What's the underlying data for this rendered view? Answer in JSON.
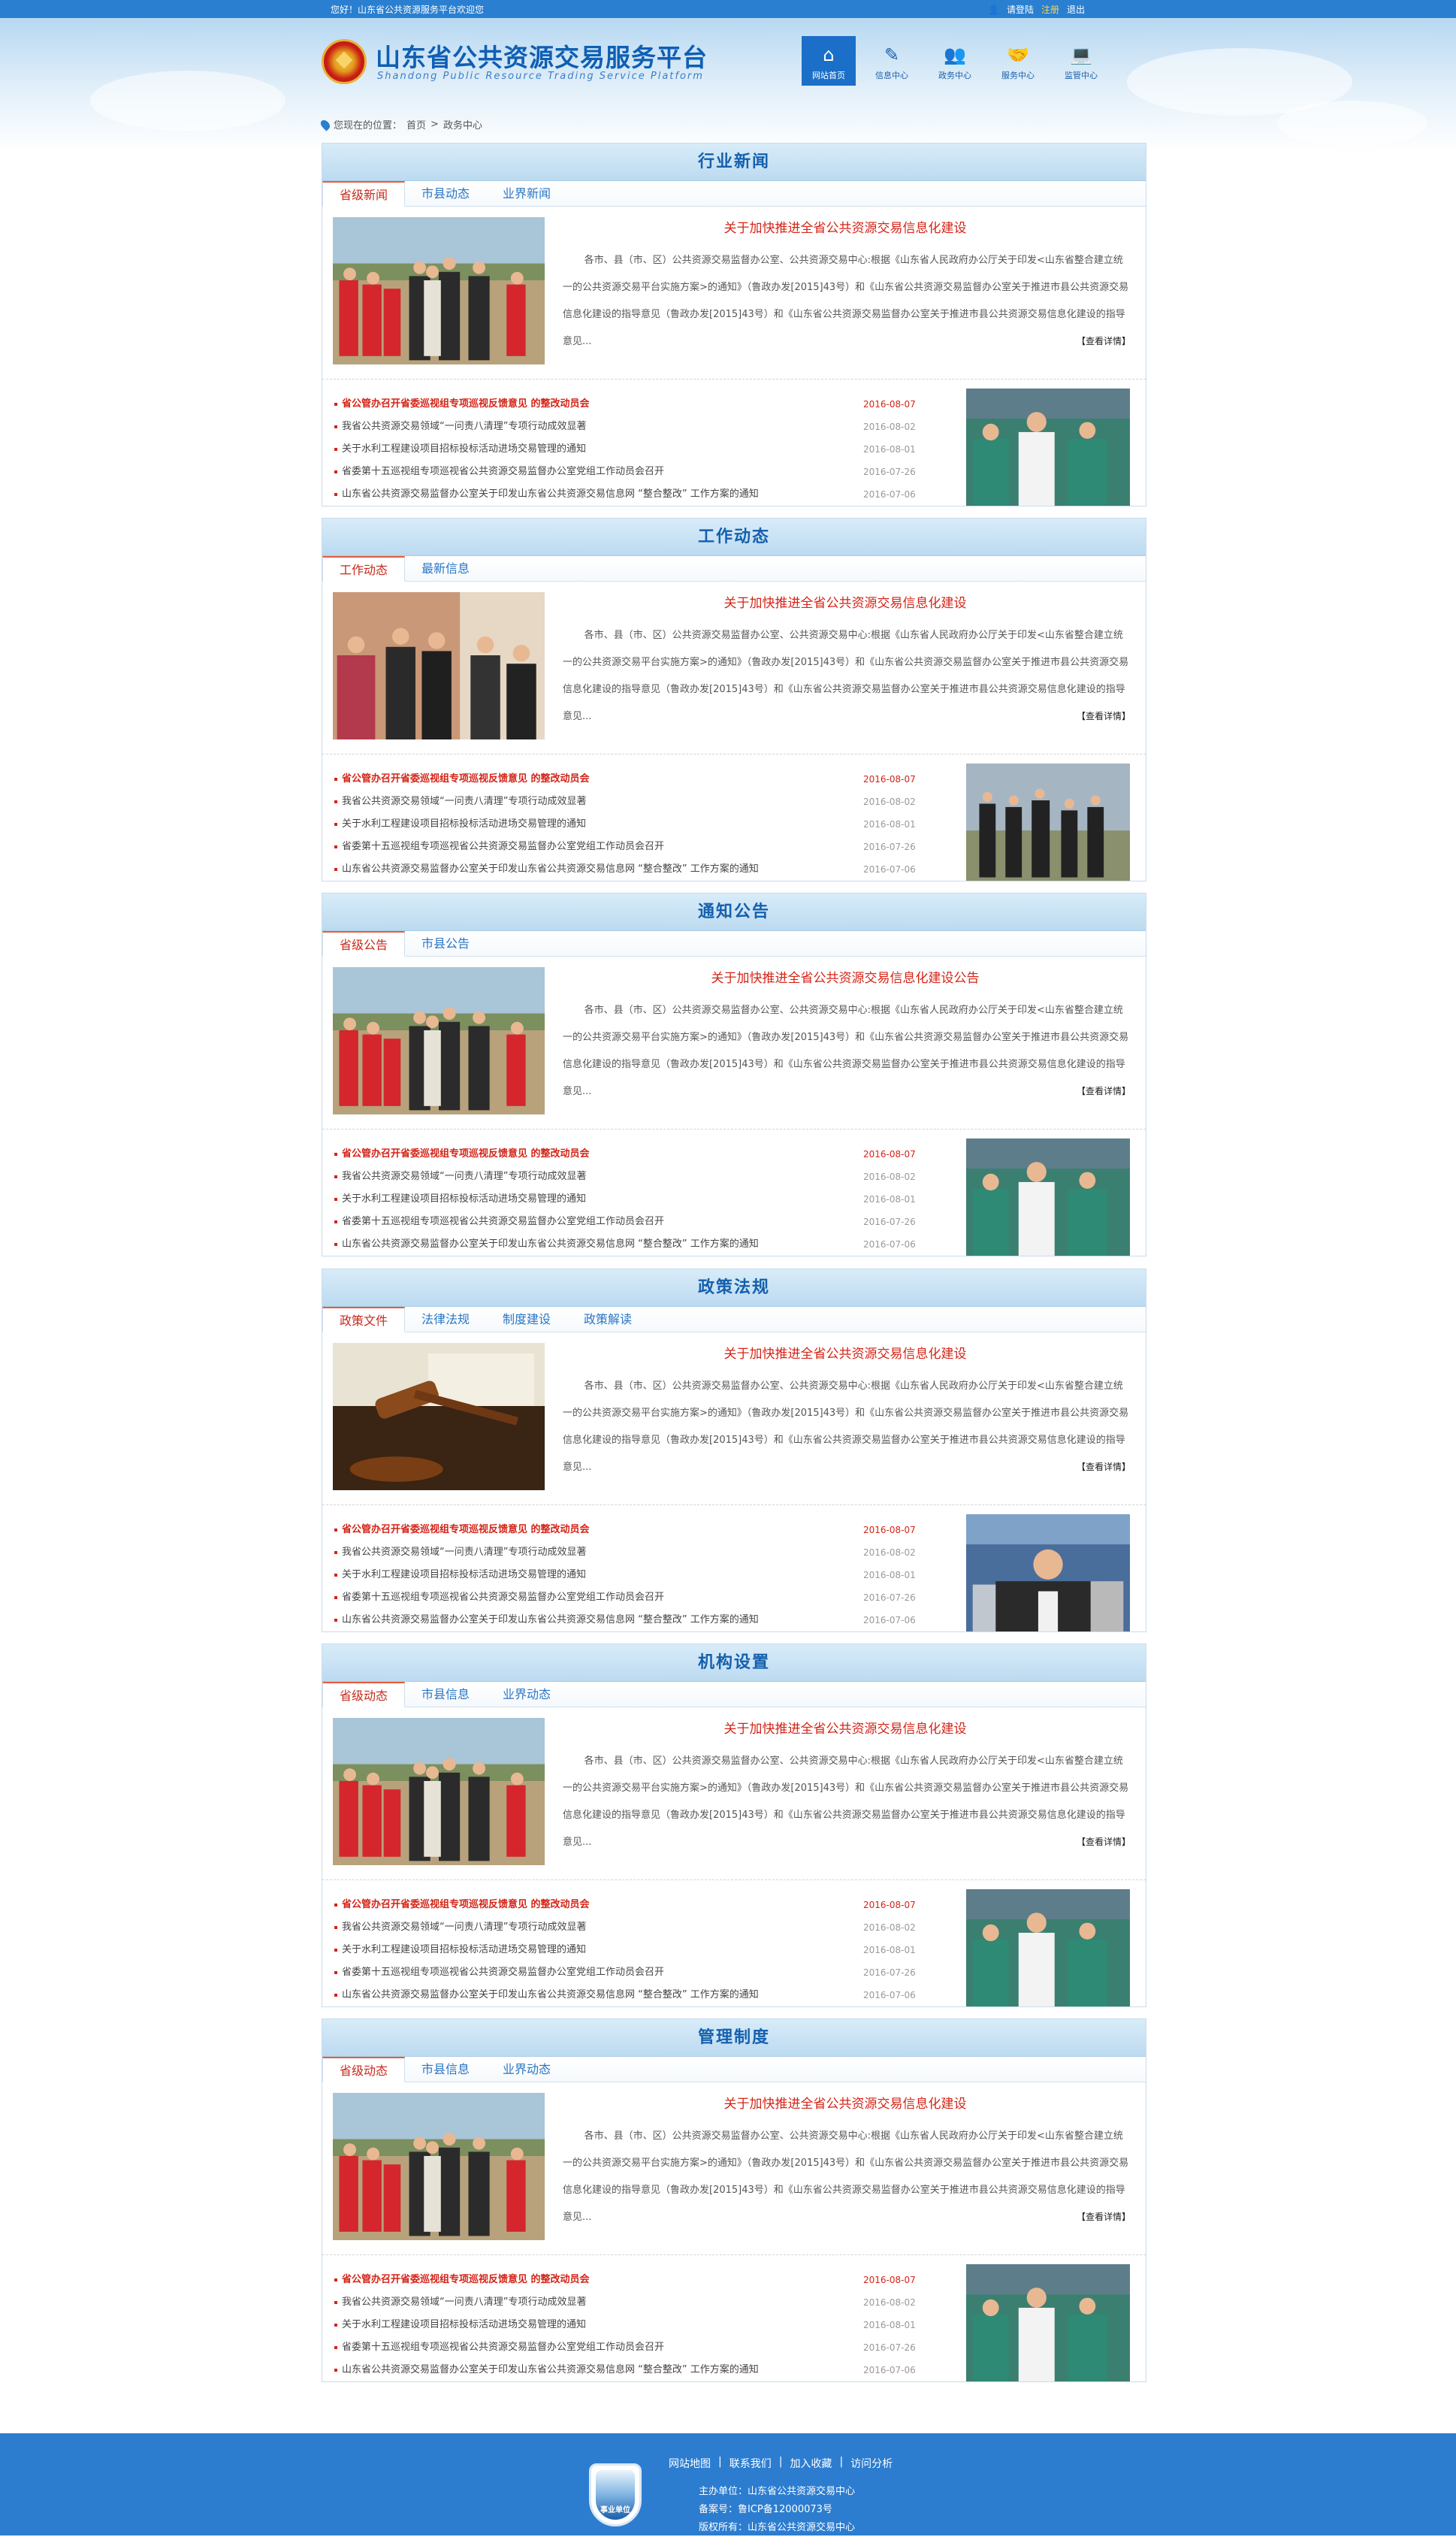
{
  "topbar": {
    "greeting": "您好！山东省公共资源服务平台欢迎您",
    "login": "请登陆",
    "register": "注册",
    "logout": "退出"
  },
  "header": {
    "title": "山东省公共资源交易服务平台",
    "subtitle": "Shandong Public Resource Trading Service Platform"
  },
  "nav": [
    {
      "label": "网站首页",
      "icon": "home-icon",
      "active": true
    },
    {
      "label": "信息中心",
      "icon": "pen-icon"
    },
    {
      "label": "政务中心",
      "icon": "users-icon"
    },
    {
      "label": "服务中心",
      "icon": "handshake-icon"
    },
    {
      "label": "监管中心",
      "icon": "computer-icon"
    }
  ],
  "breadcrumb": {
    "prefix": "您现在的位置：",
    "home": "首页",
    "sep": ">",
    "current": "政务中心"
  },
  "sections": [
    {
      "title": "行业新闻",
      "tabs": [
        "省级新闻",
        "市县动态",
        "业界新闻"
      ],
      "feature_title": "关于加快推进全省公共资源交易信息化建设",
      "summary": "各市、县（市、区）公共资源交易监督办公室、公共资源交易中心:根据《山东省人民政府办公厅关于印发<山东省整合建立统一的公共资源交易平台实施方案>的通知》（鲁政办发[2015]43号）和《山东省公共资源交易监督办公室关于推进市县公共资源交易信息化建设的指导意见（鲁政办发[2015]43号）和《山东省公共资源交易监督办公室关于推进市县公共资源交易信息化建设的指导意见...",
      "more": "【查看详情】",
      "news": [
        {
          "title": "省公管办召开省委巡视组专项巡视反馈意见 的整改动员会",
          "date": "2016-08-07",
          "hot": true
        },
        {
          "title": "我省公共资源交易领域“一问责八清理”专项行动成效显著",
          "date": "2016-08-02"
        },
        {
          "title": "关于水利工程建设项目招标投标活动进场交易管理的通知",
          "date": "2016-08-01"
        },
        {
          "title": "省委第十五巡视组专项巡视省公共资源交易监督办公室党组工作动员会召开",
          "date": "2016-07-26"
        },
        {
          "title": "山东省公共资源交易监督办公室关于印发山东省公共资源交易信息网 “整合整改” 工作方案的通知",
          "date": "2016-07-06"
        }
      ]
    },
    {
      "title": "工作动态",
      "tabs": [
        "工作动态",
        "最新信息"
      ],
      "feature_title": "关于加快推进全省公共资源交易信息化建设",
      "summary": "各市、县（市、区）公共资源交易监督办公室、公共资源交易中心:根据《山东省人民政府办公厅关于印发<山东省整合建立统一的公共资源交易平台实施方案>的通知》（鲁政办发[2015]43号）和《山东省公共资源交易监督办公室关于推进市县公共资源交易信息化建设的指导意见（鲁政办发[2015]43号）和《山东省公共资源交易监督办公室关于推进市县公共资源交易信息化建设的指导意见...",
      "more": "【查看详情】",
      "news": [
        {
          "title": "省公管办召开省委巡视组专项巡视反馈意见 的整改动员会",
          "date": "2016-08-07",
          "hot": true
        },
        {
          "title": "我省公共资源交易领域“一问责八清理”专项行动成效显著",
          "date": "2016-08-02"
        },
        {
          "title": "关于水利工程建设项目招标投标活动进场交易管理的通知",
          "date": "2016-08-01"
        },
        {
          "title": "省委第十五巡视组专项巡视省公共资源交易监督办公室党组工作动员会召开",
          "date": "2016-07-26"
        },
        {
          "title": "山东省公共资源交易监督办公室关于印发山东省公共资源交易信息网 “整合整改” 工作方案的通知",
          "date": "2016-07-06"
        }
      ]
    },
    {
      "title": "通知公告",
      "tabs": [
        "省级公告",
        "市县公告"
      ],
      "feature_title": "关于加快推进全省公共资源交易信息化建设公告",
      "summary": "各市、县（市、区）公共资源交易监督办公室、公共资源交易中心:根据《山东省人民政府办公厅关于印发<山东省整合建立统一的公共资源交易平台实施方案>的通知》（鲁政办发[2015]43号）和《山东省公共资源交易监督办公室关于推进市县公共资源交易信息化建设的指导意见（鲁政办发[2015]43号）和《山东省公共资源交易监督办公室关于推进市县公共资源交易信息化建设的指导意见...",
      "more": "【查看详情】",
      "news": [
        {
          "title": "省公管办召开省委巡视组专项巡视反馈意见 的整改动员会",
          "date": "2016-08-07",
          "hot": true
        },
        {
          "title": "我省公共资源交易领域“一问责八清理”专项行动成效显著",
          "date": "2016-08-02"
        },
        {
          "title": "关于水利工程建设项目招标投标活动进场交易管理的通知",
          "date": "2016-08-01"
        },
        {
          "title": "省委第十五巡视组专项巡视省公共资源交易监督办公室党组工作动员会召开",
          "date": "2016-07-26"
        },
        {
          "title": "山东省公共资源交易监督办公室关于印发山东省公共资源交易信息网 “整合整改” 工作方案的通知",
          "date": "2016-07-06"
        }
      ]
    },
    {
      "title": "政策法规",
      "tabs": [
        "政策文件",
        "法律法规",
        "制度建设",
        "政策解读"
      ],
      "feature_title": "关于加快推进全省公共资源交易信息化建设",
      "summary": "各市、县（市、区）公共资源交易监督办公室、公共资源交易中心:根据《山东省人民政府办公厅关于印发<山东省整合建立统一的公共资源交易平台实施方案>的通知》（鲁政办发[2015]43号）和《山东省公共资源交易监督办公室关于推进市县公共资源交易信息化建设的指导意见（鲁政办发[2015]43号）和《山东省公共资源交易监督办公室关于推进市县公共资源交易信息化建设的指导意见...",
      "more": "【查看详情】",
      "news": [
        {
          "title": "省公管办召开省委巡视组专项巡视反馈意见 的整改动员会",
          "date": "2016-08-07",
          "hot": true
        },
        {
          "title": "我省公共资源交易领域“一问责八清理”专项行动成效显著",
          "date": "2016-08-02"
        },
        {
          "title": "关于水利工程建设项目招标投标活动进场交易管理的通知",
          "date": "2016-08-01"
        },
        {
          "title": "省委第十五巡视组专项巡视省公共资源交易监督办公室党组工作动员会召开",
          "date": "2016-07-26"
        },
        {
          "title": "山东省公共资源交易监督办公室关于印发山东省公共资源交易信息网 “整合整改” 工作方案的通知",
          "date": "2016-07-06"
        }
      ]
    },
    {
      "title": "机构设置",
      "tabs": [
        "省级动态",
        "市县信息",
        "业界动态"
      ],
      "feature_title": "关于加快推进全省公共资源交易信息化建设",
      "summary": "各市、县（市、区）公共资源交易监督办公室、公共资源交易中心:根据《山东省人民政府办公厅关于印发<山东省整合建立统一的公共资源交易平台实施方案>的通知》（鲁政办发[2015]43号）和《山东省公共资源交易监督办公室关于推进市县公共资源交易信息化建设的指导意见（鲁政办发[2015]43号）和《山东省公共资源交易监督办公室关于推进市县公共资源交易信息化建设的指导意见...",
      "more": "【查看详情】",
      "news": [
        {
          "title": "省公管办召开省委巡视组专项巡视反馈意见 的整改动员会",
          "date": "2016-08-07",
          "hot": true
        },
        {
          "title": "我省公共资源交易领域“一问责八清理”专项行动成效显著",
          "date": "2016-08-02"
        },
        {
          "title": "关于水利工程建设项目招标投标活动进场交易管理的通知",
          "date": "2016-08-01"
        },
        {
          "title": "省委第十五巡视组专项巡视省公共资源交易监督办公室党组工作动员会召开",
          "date": "2016-07-26"
        },
        {
          "title": "山东省公共资源交易监督办公室关于印发山东省公共资源交易信息网 “整合整改” 工作方案的通知",
          "date": "2016-07-06"
        }
      ]
    },
    {
      "title": "管理制度",
      "tabs": [
        "省级动态",
        "市县信息",
        "业界动态"
      ],
      "feature_title": "关于加快推进全省公共资源交易信息化建设",
      "summary": "各市、县（市、区）公共资源交易监督办公室、公共资源交易中心:根据《山东省人民政府办公厅关于印发<山东省整合建立统一的公共资源交易平台实施方案>的通知》（鲁政办发[2015]43号）和《山东省公共资源交易监督办公室关于推进市县公共资源交易信息化建设的指导意见（鲁政办发[2015]43号）和《山东省公共资源交易监督办公室关于推进市县公共资源交易信息化建设的指导意见...",
      "more": "【查看详情】",
      "news": [
        {
          "title": "省公管办召开省委巡视组专项巡视反馈意见 的整改动员会",
          "date": "2016-08-07",
          "hot": true
        },
        {
          "title": "我省公共资源交易领域“一问责八清理”专项行动成效显著",
          "date": "2016-08-02"
        },
        {
          "title": "关于水利工程建设项目招标投标活动进场交易管理的通知",
          "date": "2016-08-01"
        },
        {
          "title": "省委第十五巡视组专项巡视省公共资源交易监督办公室党组工作动员会召开",
          "date": "2016-07-26"
        },
        {
          "title": "山东省公共资源交易监督办公室关于印发山东省公共资源交易信息网 “整合整改” 工作方案的通知",
          "date": "2016-07-06"
        }
      ]
    }
  ],
  "footer": {
    "links": [
      "网站地图",
      "联系我们",
      "加入收藏",
      "访问分析"
    ],
    "sep": "|",
    "organizer": "主办单位：山东省公共资源交易中心",
    "icp": "备案号：鲁ICP备12000073号",
    "copyright": "版权所有：山东省公共资源交易中心",
    "badge": "事业单位"
  },
  "colors": {
    "primary": "#2a7fd0",
    "accent": "#d42417",
    "title": "#1560ad"
  }
}
